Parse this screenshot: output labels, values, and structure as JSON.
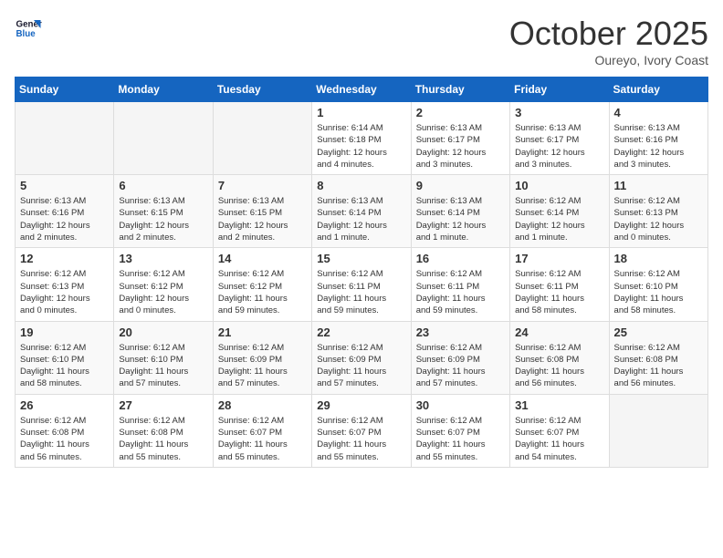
{
  "header": {
    "logo_line1": "General",
    "logo_line2": "Blue",
    "month": "October 2025",
    "location": "Oureyo, Ivory Coast"
  },
  "weekdays": [
    "Sunday",
    "Monday",
    "Tuesday",
    "Wednesday",
    "Thursday",
    "Friday",
    "Saturday"
  ],
  "weeks": [
    [
      {
        "day": "",
        "info": ""
      },
      {
        "day": "",
        "info": ""
      },
      {
        "day": "",
        "info": ""
      },
      {
        "day": "1",
        "info": "Sunrise: 6:14 AM\nSunset: 6:18 PM\nDaylight: 12 hours\nand 4 minutes."
      },
      {
        "day": "2",
        "info": "Sunrise: 6:13 AM\nSunset: 6:17 PM\nDaylight: 12 hours\nand 3 minutes."
      },
      {
        "day": "3",
        "info": "Sunrise: 6:13 AM\nSunset: 6:17 PM\nDaylight: 12 hours\nand 3 minutes."
      },
      {
        "day": "4",
        "info": "Sunrise: 6:13 AM\nSunset: 6:16 PM\nDaylight: 12 hours\nand 3 minutes."
      }
    ],
    [
      {
        "day": "5",
        "info": "Sunrise: 6:13 AM\nSunset: 6:16 PM\nDaylight: 12 hours\nand 2 minutes."
      },
      {
        "day": "6",
        "info": "Sunrise: 6:13 AM\nSunset: 6:15 PM\nDaylight: 12 hours\nand 2 minutes."
      },
      {
        "day": "7",
        "info": "Sunrise: 6:13 AM\nSunset: 6:15 PM\nDaylight: 12 hours\nand 2 minutes."
      },
      {
        "day": "8",
        "info": "Sunrise: 6:13 AM\nSunset: 6:14 PM\nDaylight: 12 hours\nand 1 minute."
      },
      {
        "day": "9",
        "info": "Sunrise: 6:13 AM\nSunset: 6:14 PM\nDaylight: 12 hours\nand 1 minute."
      },
      {
        "day": "10",
        "info": "Sunrise: 6:12 AM\nSunset: 6:14 PM\nDaylight: 12 hours\nand 1 minute."
      },
      {
        "day": "11",
        "info": "Sunrise: 6:12 AM\nSunset: 6:13 PM\nDaylight: 12 hours\nand 0 minutes."
      }
    ],
    [
      {
        "day": "12",
        "info": "Sunrise: 6:12 AM\nSunset: 6:13 PM\nDaylight: 12 hours\nand 0 minutes."
      },
      {
        "day": "13",
        "info": "Sunrise: 6:12 AM\nSunset: 6:12 PM\nDaylight: 12 hours\nand 0 minutes."
      },
      {
        "day": "14",
        "info": "Sunrise: 6:12 AM\nSunset: 6:12 PM\nDaylight: 11 hours\nand 59 minutes."
      },
      {
        "day": "15",
        "info": "Sunrise: 6:12 AM\nSunset: 6:11 PM\nDaylight: 11 hours\nand 59 minutes."
      },
      {
        "day": "16",
        "info": "Sunrise: 6:12 AM\nSunset: 6:11 PM\nDaylight: 11 hours\nand 59 minutes."
      },
      {
        "day": "17",
        "info": "Sunrise: 6:12 AM\nSunset: 6:11 PM\nDaylight: 11 hours\nand 58 minutes."
      },
      {
        "day": "18",
        "info": "Sunrise: 6:12 AM\nSunset: 6:10 PM\nDaylight: 11 hours\nand 58 minutes."
      }
    ],
    [
      {
        "day": "19",
        "info": "Sunrise: 6:12 AM\nSunset: 6:10 PM\nDaylight: 11 hours\nand 58 minutes."
      },
      {
        "day": "20",
        "info": "Sunrise: 6:12 AM\nSunset: 6:10 PM\nDaylight: 11 hours\nand 57 minutes."
      },
      {
        "day": "21",
        "info": "Sunrise: 6:12 AM\nSunset: 6:09 PM\nDaylight: 11 hours\nand 57 minutes."
      },
      {
        "day": "22",
        "info": "Sunrise: 6:12 AM\nSunset: 6:09 PM\nDaylight: 11 hours\nand 57 minutes."
      },
      {
        "day": "23",
        "info": "Sunrise: 6:12 AM\nSunset: 6:09 PM\nDaylight: 11 hours\nand 57 minutes."
      },
      {
        "day": "24",
        "info": "Sunrise: 6:12 AM\nSunset: 6:08 PM\nDaylight: 11 hours\nand 56 minutes."
      },
      {
        "day": "25",
        "info": "Sunrise: 6:12 AM\nSunset: 6:08 PM\nDaylight: 11 hours\nand 56 minutes."
      }
    ],
    [
      {
        "day": "26",
        "info": "Sunrise: 6:12 AM\nSunset: 6:08 PM\nDaylight: 11 hours\nand 56 minutes."
      },
      {
        "day": "27",
        "info": "Sunrise: 6:12 AM\nSunset: 6:08 PM\nDaylight: 11 hours\nand 55 minutes."
      },
      {
        "day": "28",
        "info": "Sunrise: 6:12 AM\nSunset: 6:07 PM\nDaylight: 11 hours\nand 55 minutes."
      },
      {
        "day": "29",
        "info": "Sunrise: 6:12 AM\nSunset: 6:07 PM\nDaylight: 11 hours\nand 55 minutes."
      },
      {
        "day": "30",
        "info": "Sunrise: 6:12 AM\nSunset: 6:07 PM\nDaylight: 11 hours\nand 55 minutes."
      },
      {
        "day": "31",
        "info": "Sunrise: 6:12 AM\nSunset: 6:07 PM\nDaylight: 11 hours\nand 54 minutes."
      },
      {
        "day": "",
        "info": ""
      }
    ]
  ]
}
